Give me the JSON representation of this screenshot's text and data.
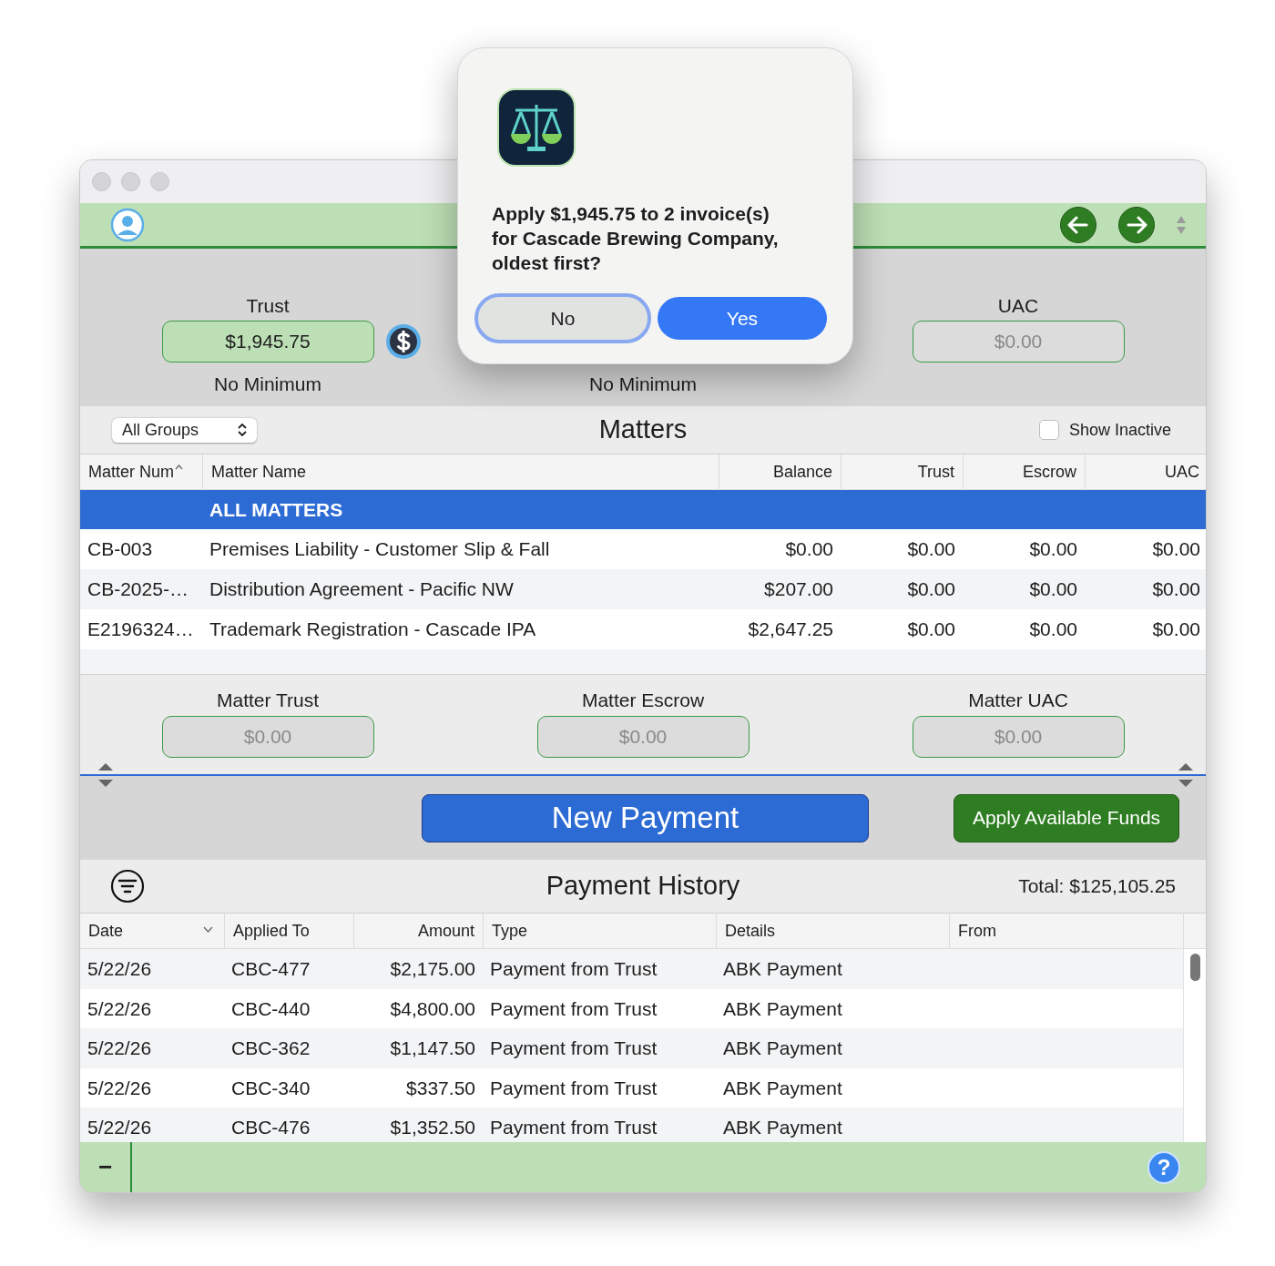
{
  "summary": {
    "trust": {
      "label": "Trust",
      "value": "$1,945.75",
      "note": "No Minimum"
    },
    "middle_note": "No Minimum",
    "uac": {
      "label": "UAC",
      "placeholder": "$0.00"
    }
  },
  "matters": {
    "group_select": "All Groups",
    "title": "Matters",
    "show_inactive": {
      "label": "Show Inactive",
      "checked": false
    },
    "columns": [
      {
        "label": "Matter Num",
        "sorted": true
      },
      {
        "label": "Matter Name",
        "sorted": false
      },
      {
        "label": "Balance",
        "sorted": false
      },
      {
        "label": "Trust",
        "sorted": false
      },
      {
        "label": "Escrow",
        "sorted": false
      },
      {
        "label": "UAC",
        "sorted": false
      }
    ],
    "rows": [
      {
        "cells": [
          "",
          "ALL MATTERS",
          "",
          "",
          "",
          ""
        ],
        "selected": true
      },
      {
        "cells": [
          "CB-003",
          "Premises Liability - Customer Slip & Fall",
          "$0.00",
          "$0.00",
          "$0.00",
          "$0.00"
        ],
        "selected": false
      },
      {
        "cells": [
          "CB-2025-…",
          "Distribution Agreement - Pacific NW",
          "$207.00",
          "$0.00",
          "$0.00",
          "$0.00"
        ],
        "selected": false
      },
      {
        "cells": [
          "E2196324…",
          "Trademark Registration - Cascade IPA",
          "$2,647.25",
          "$0.00",
          "$0.00",
          "$0.00"
        ],
        "selected": false
      }
    ]
  },
  "matter_totals": [
    {
      "label": "Matter Trust",
      "placeholder": "$0.00"
    },
    {
      "label": "Matter Escrow",
      "placeholder": "$0.00"
    },
    {
      "label": "Matter UAC",
      "placeholder": "$0.00"
    }
  ],
  "actions": {
    "new_payment": "New Payment",
    "apply_funds": "Apply Available Funds"
  },
  "payment_history": {
    "title": "Payment History",
    "total": "Total: $125,105.25",
    "columns": [
      {
        "label": "Date",
        "sorted": true
      },
      {
        "label": "Applied To",
        "sorted": false
      },
      {
        "label": "Amount",
        "sorted": false
      },
      {
        "label": "Type",
        "sorted": false
      },
      {
        "label": "Details",
        "sorted": false
      },
      {
        "label": "From",
        "sorted": false
      }
    ],
    "rows": [
      [
        "5/22/26",
        "CBC-477",
        "$2,175.00",
        "Payment from Trust",
        "ABK Payment",
        ""
      ],
      [
        "5/22/26",
        "CBC-440",
        "$4,800.00",
        "Payment from Trust",
        "ABK Payment",
        ""
      ],
      [
        "5/22/26",
        "CBC-362",
        "$1,147.50",
        "Payment from Trust",
        "ABK Payment",
        ""
      ],
      [
        "5/22/26",
        "CBC-340",
        "$337.50",
        "Payment from Trust",
        "ABK Payment",
        ""
      ],
      [
        "5/22/26",
        "CBC-476",
        "$1,352.50",
        "Payment from Trust",
        "ABK Payment",
        ""
      ]
    ]
  },
  "bottom_bar": {
    "remove": "−",
    "help": "?"
  },
  "dialog": {
    "message": "Apply $1,945.75 to 2 invoice(s) for Cascade Brewing Company, oldest first?",
    "buttons": [
      {
        "label": "No",
        "focused": true,
        "default": false
      },
      {
        "label": "Yes",
        "focused": false,
        "default": true
      }
    ]
  }
}
